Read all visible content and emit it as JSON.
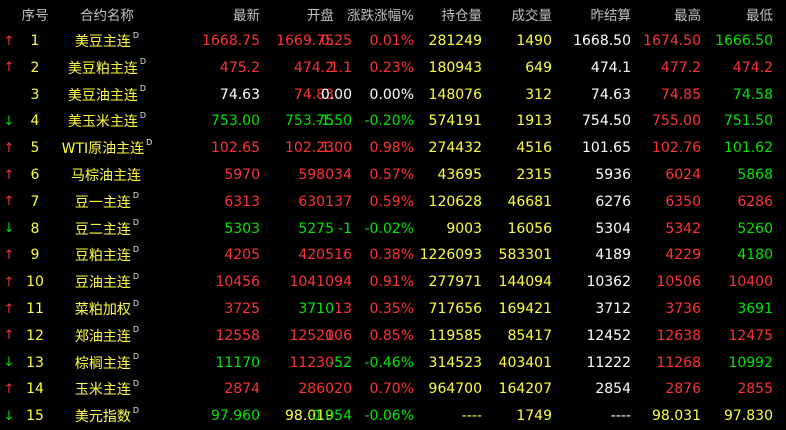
{
  "columns": {
    "index": "序号",
    "name": "合约名称",
    "last": "最新",
    "open": "开盘",
    "change": "涨跌",
    "change_pct": "涨幅%",
    "open_interest": "持仓量",
    "volume": "成交量",
    "prev_settle": "昨结算",
    "high": "最高",
    "low": "最低"
  },
  "colors": {
    "up": "#ff3232",
    "down": "#00e600",
    "flat": "#ffffff",
    "neutral": "#ffff3c"
  },
  "rows": [
    {
      "idx": "1",
      "trend": "up",
      "name": "美豆主连",
      "mark": "D",
      "last": "1668.75",
      "open": "1669.75",
      "chg": "0.25",
      "pct": "0.01%",
      "oi": "281249",
      "vol": "1490",
      "settle": "1668.50",
      "high": "1674.50",
      "low": "1666.50"
    },
    {
      "idx": "2",
      "trend": "up",
      "name": "美豆粕主连",
      "mark": "D",
      "last": "475.2",
      "open": "474.2",
      "chg": "1.1",
      "pct": "0.23%",
      "oi": "180943",
      "vol": "649",
      "settle": "474.1",
      "high": "477.2",
      "low": "474.2"
    },
    {
      "idx": "3",
      "trend": "flat",
      "name": "美豆油主连",
      "mark": "D",
      "last": "74.63",
      "open": "74.83",
      "chg": "0.00",
      "pct": "0.00%",
      "oi": "148076",
      "vol": "312",
      "settle": "74.63",
      "high": "74.85",
      "low": "74.58"
    },
    {
      "idx": "4",
      "trend": "down",
      "name": "美玉米主连",
      "mark": "D",
      "last": "753.00",
      "open": "753.75",
      "chg": "-1.50",
      "pct": "-0.20%",
      "oi": "574191",
      "vol": "1913",
      "settle": "754.50",
      "high": "755.00",
      "low": "751.50"
    },
    {
      "idx": "5",
      "trend": "up",
      "name": "WTI原油主连",
      "mark": "D",
      "last": "102.65",
      "open": "102.23",
      "chg": "1.00",
      "pct": "0.98%",
      "oi": "274432",
      "vol": "4516",
      "settle": "101.65",
      "high": "102.76",
      "low": "101.62"
    },
    {
      "idx": "6",
      "trend": "up",
      "name": "马棕油主连",
      "mark": "",
      "last": "5970",
      "open": "5980",
      "chg": "34",
      "pct": "0.57%",
      "oi": "43695",
      "vol": "2315",
      "settle": "5936",
      "high": "6024",
      "low": "5868"
    },
    {
      "idx": "7",
      "trend": "up",
      "name": "豆一主连",
      "mark": "D",
      "last": "6313",
      "open": "6301",
      "chg": "37",
      "pct": "0.59%",
      "oi": "120628",
      "vol": "46681",
      "settle": "6276",
      "high": "6350",
      "low": "6286"
    },
    {
      "idx": "8",
      "trend": "down",
      "name": "豆二主连",
      "mark": "D",
      "last": "5303",
      "open": "5275",
      "chg": "-1",
      "pct": "-0.02%",
      "oi": "9003",
      "vol": "16056",
      "settle": "5304",
      "high": "5342",
      "low": "5260"
    },
    {
      "idx": "9",
      "trend": "up",
      "name": "豆粕主连",
      "mark": "D",
      "last": "4205",
      "open": "4205",
      "chg": "16",
      "pct": "0.38%",
      "oi": "1226093",
      "vol": "583301",
      "settle": "4189",
      "high": "4229",
      "low": "4180"
    },
    {
      "idx": "10",
      "trend": "up",
      "name": "豆油主连",
      "mark": "D",
      "last": "10456",
      "open": "10410",
      "chg": "94",
      "pct": "0.91%",
      "oi": "277971",
      "vol": "144094",
      "settle": "10362",
      "high": "10506",
      "low": "10400"
    },
    {
      "idx": "11",
      "trend": "up",
      "name": "菜粕加权",
      "mark": "D",
      "last": "3725",
      "open": "3710",
      "chg": "13",
      "pct": "0.35%",
      "oi": "717656",
      "vol": "169421",
      "settle": "3712",
      "high": "3736",
      "low": "3691"
    },
    {
      "idx": "12",
      "trend": "up",
      "name": "郑油主连",
      "mark": "D",
      "last": "12558",
      "open": "12520",
      "chg": "106",
      "pct": "0.85%",
      "oi": "119585",
      "vol": "85417",
      "settle": "12452",
      "high": "12638",
      "low": "12475"
    },
    {
      "idx": "13",
      "trend": "down",
      "name": "棕榈主连",
      "mark": "D",
      "last": "11170",
      "open": "11230",
      "chg": "-52",
      "pct": "-0.46%",
      "oi": "314523",
      "vol": "403401",
      "settle": "11222",
      "high": "11268",
      "low": "10992"
    },
    {
      "idx": "14",
      "trend": "up",
      "name": "玉米主连",
      "mark": "D",
      "last": "2874",
      "open": "2860",
      "chg": "20",
      "pct": "0.70%",
      "oi": "964700",
      "vol": "164207",
      "settle": "2854",
      "high": "2876",
      "low": "2855"
    },
    {
      "idx": "15",
      "trend": "down",
      "name": "美元指数",
      "mark": "D",
      "last": "97.960",
      "open": "98.019",
      "chg": "-0.054",
      "pct": "-0.06%",
      "oi": "----",
      "vol": "1749",
      "settle": "----",
      "high": "98.031",
      "low": "97.830"
    }
  ]
}
